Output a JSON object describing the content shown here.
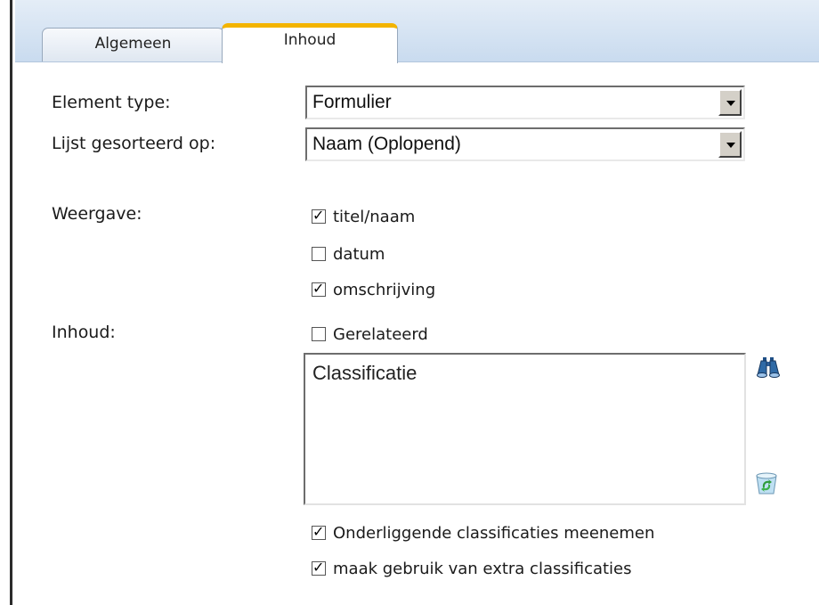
{
  "tabs": [
    {
      "label": "Algemeen",
      "active": false
    },
    {
      "label": "Inhoud",
      "active": true
    }
  ],
  "form": {
    "element_type": {
      "label": "Element type:",
      "value": "Formulier"
    },
    "sort": {
      "label": "Lijst gesorteerd op:",
      "value": "Naam (Oplopend)"
    },
    "display": {
      "label": "Weergave:",
      "options": [
        {
          "label": "titel/naam",
          "checked": true
        },
        {
          "label": "datum",
          "checked": false
        },
        {
          "label": "omschrijving",
          "checked": true
        }
      ]
    },
    "content": {
      "label": "Inhoud:",
      "related": {
        "label": "Gerelateerd",
        "checked": false
      },
      "list_items": [
        "Classificatie"
      ],
      "underlying": {
        "label": "Onderliggende classificaties meenemen",
        "checked": true
      },
      "extra": {
        "label": "maak gebruik van extra classificaties",
        "checked": true
      }
    }
  },
  "icons": {
    "search": "binoculars-icon",
    "delete": "recycle-bin-icon"
  },
  "colors": {
    "active_tab_accent": "#f3b400",
    "tab_strip": "#c9dbef"
  }
}
